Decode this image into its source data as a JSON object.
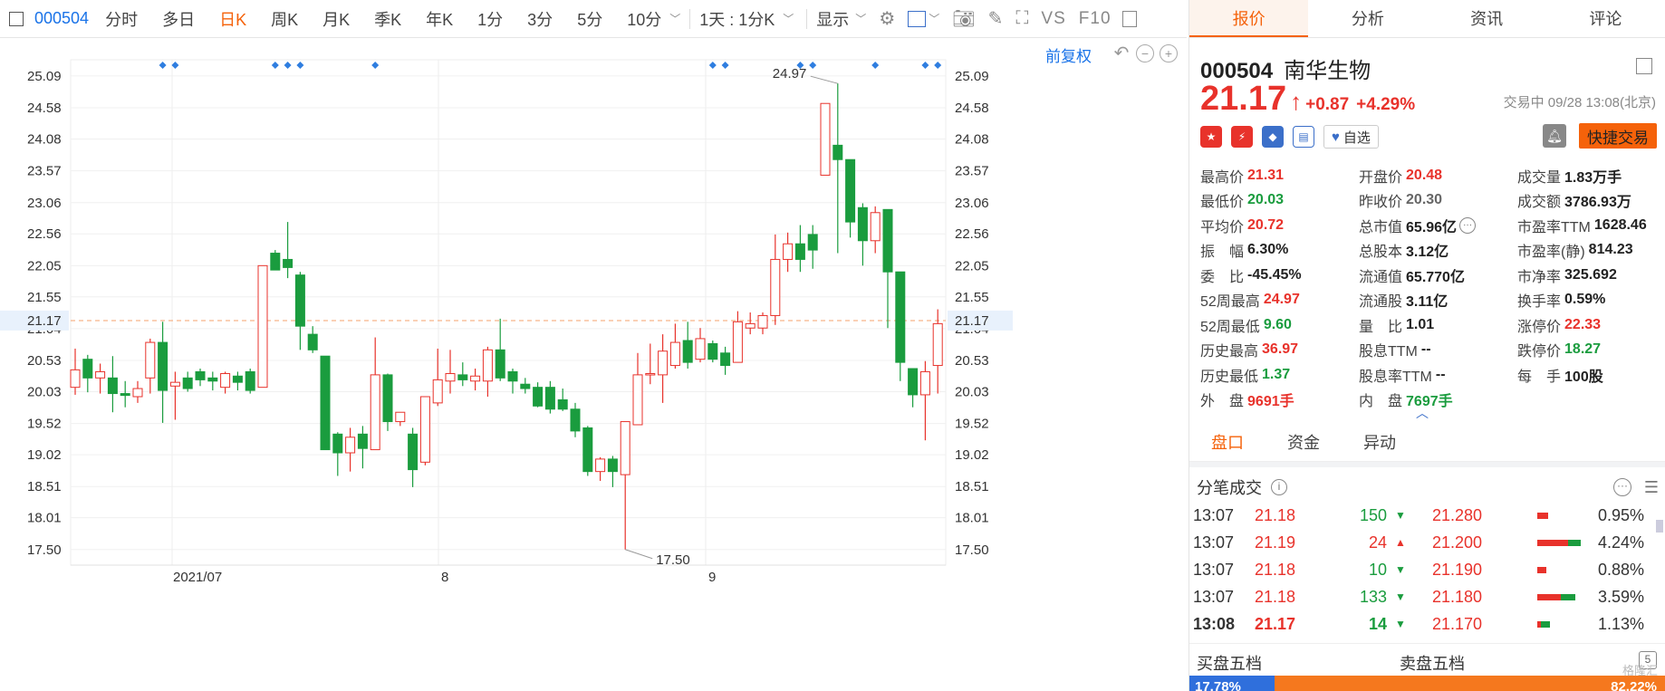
{
  "toolbar": {
    "code": "000504",
    "periods": [
      "分时",
      "多日",
      "日K",
      "周K",
      "月K",
      "季K",
      "年K",
      "1分",
      "3分",
      "5分",
      "10分"
    ],
    "active_period": "日K",
    "interval": "1天 : 1分K",
    "display": "显示",
    "vs": "VS",
    "f10": "F10"
  },
  "chart": {
    "fuquan": "前复权",
    "last_price_tag": "21.17",
    "high_annotation": "24.97",
    "low_annotation": "17.50"
  },
  "chart_data": {
    "type": "candlestick",
    "y_ticks": [
      "25.09",
      "24.58",
      "24.08",
      "23.57",
      "23.06",
      "22.56",
      "22.05",
      "21.55",
      "21.04",
      "20.53",
      "20.03",
      "19.52",
      "19.02",
      "18.51",
      "18.01",
      "17.50"
    ],
    "x_ticks": [
      "2021/07",
      "8",
      "9"
    ],
    "ylim": [
      17.25,
      25.35
    ],
    "last_price": 21.17,
    "colors": {
      "up": "#e8322b",
      "down": "#1a9c3e",
      "dashed_line": "#f5a26e"
    },
    "marker_groups": [
      [
        7,
        8
      ],
      [
        16,
        17,
        18
      ],
      [
        24
      ],
      [
        51,
        52
      ],
      [
        58,
        59
      ],
      [
        64
      ],
      [
        68,
        69
      ]
    ],
    "candles": [
      {
        "o": 20.1,
        "c": 20.38,
        "h": 20.72,
        "l": 19.98
      },
      {
        "o": 20.55,
        "c": 20.25,
        "h": 20.62,
        "l": 20.02
      },
      {
        "o": 20.25,
        "c": 20.35,
        "h": 20.48,
        "l": 20.0
      },
      {
        "o": 20.25,
        "c": 20.0,
        "h": 20.6,
        "l": 19.7
      },
      {
        "o": 20.0,
        "c": 19.97,
        "h": 20.2,
        "l": 19.78
      },
      {
        "o": 19.95,
        "c": 20.08,
        "h": 20.2,
        "l": 19.85
      },
      {
        "o": 20.25,
        "c": 20.82,
        "h": 20.88,
        "l": 20.0
      },
      {
        "o": 20.82,
        "c": 20.05,
        "h": 21.15,
        "l": 19.53
      },
      {
        "o": 20.12,
        "c": 20.18,
        "h": 20.35,
        "l": 19.58
      },
      {
        "o": 20.25,
        "c": 20.08,
        "h": 20.35,
        "l": 20.03
      },
      {
        "o": 20.35,
        "c": 20.22,
        "h": 20.4,
        "l": 20.12
      },
      {
        "o": 20.25,
        "c": 20.2,
        "h": 20.35,
        "l": 20.05
      },
      {
        "o": 20.1,
        "c": 20.32,
        "h": 20.35,
        "l": 20.0
      },
      {
        "o": 20.28,
        "c": 20.18,
        "h": 20.35,
        "l": 20.05
      },
      {
        "o": 20.35,
        "c": 20.05,
        "h": 20.4,
        "l": 20.0
      },
      {
        "o": 20.1,
        "c": 22.05,
        "h": 22.05,
        "l": 20.1
      },
      {
        "o": 22.25,
        "c": 21.98,
        "h": 22.3,
        "l": 21.98
      },
      {
        "o": 22.15,
        "c": 22.02,
        "h": 22.75,
        "l": 21.85
      },
      {
        "o": 21.9,
        "c": 21.08,
        "h": 21.95,
        "l": 20.7
      },
      {
        "o": 20.95,
        "c": 20.7,
        "h": 21.08,
        "l": 20.65
      },
      {
        "o": 20.6,
        "c": 19.1,
        "h": 20.6,
        "l": 19.1
      },
      {
        "o": 19.35,
        "c": 19.05,
        "h": 19.38,
        "l": 18.68
      },
      {
        "o": 19.05,
        "c": 19.3,
        "h": 19.45,
        "l": 18.75
      },
      {
        "o": 19.35,
        "c": 19.12,
        "h": 19.48,
        "l": 18.8
      },
      {
        "o": 19.1,
        "c": 20.3,
        "h": 20.9,
        "l": 19.1
      },
      {
        "o": 20.3,
        "c": 19.55,
        "h": 20.32,
        "l": 19.4
      },
      {
        "o": 19.55,
        "c": 19.7,
        "h": 19.7,
        "l": 19.48
      },
      {
        "o": 19.35,
        "c": 18.78,
        "h": 19.45,
        "l": 18.5
      },
      {
        "o": 18.9,
        "c": 19.95,
        "h": 19.95,
        "l": 18.85
      },
      {
        "o": 19.85,
        "c": 20.22,
        "h": 20.72,
        "l": 19.8
      },
      {
        "o": 20.2,
        "c": 20.32,
        "h": 20.7,
        "l": 20.0
      },
      {
        "o": 20.3,
        "c": 20.22,
        "h": 20.5,
        "l": 20.12
      },
      {
        "o": 20.2,
        "c": 20.28,
        "h": 20.4,
        "l": 20.05
      },
      {
        "o": 20.2,
        "c": 20.7,
        "h": 20.75,
        "l": 19.95
      },
      {
        "o": 20.7,
        "c": 20.25,
        "h": 21.2,
        "l": 20.2
      },
      {
        "o": 20.35,
        "c": 20.2,
        "h": 20.4,
        "l": 20.0
      },
      {
        "o": 20.15,
        "c": 20.08,
        "h": 20.25,
        "l": 20.0
      },
      {
        "o": 20.1,
        "c": 19.8,
        "h": 20.18,
        "l": 19.78
      },
      {
        "o": 20.1,
        "c": 19.75,
        "h": 20.2,
        "l": 19.68
      },
      {
        "o": 19.9,
        "c": 19.75,
        "h": 20.08,
        "l": 19.72
      },
      {
        "o": 19.75,
        "c": 19.4,
        "h": 19.85,
        "l": 19.3
      },
      {
        "o": 19.45,
        "c": 18.75,
        "h": 19.48,
        "l": 18.68
      },
      {
        "o": 18.75,
        "c": 18.95,
        "h": 18.98,
        "l": 18.6
      },
      {
        "o": 18.95,
        "c": 18.75,
        "h": 19.0,
        "l": 18.5
      },
      {
        "o": 18.7,
        "c": 19.55,
        "h": 19.55,
        "l": 17.5
      },
      {
        "o": 19.5,
        "c": 20.3,
        "h": 20.65,
        "l": 19.5
      },
      {
        "o": 20.3,
        "c": 20.32,
        "h": 20.8,
        "l": 20.15
      },
      {
        "o": 20.3,
        "c": 20.68,
        "h": 20.95,
        "l": 19.85
      },
      {
        "o": 20.45,
        "c": 20.82,
        "h": 21.12,
        "l": 20.4
      },
      {
        "o": 20.85,
        "c": 20.5,
        "h": 21.15,
        "l": 20.4
      },
      {
        "o": 20.55,
        "c": 20.88,
        "h": 21.05,
        "l": 20.5
      },
      {
        "o": 20.8,
        "c": 20.55,
        "h": 20.85,
        "l": 20.5
      },
      {
        "o": 20.65,
        "c": 20.45,
        "h": 20.75,
        "l": 20.3
      },
      {
        "o": 20.5,
        "c": 21.15,
        "h": 21.32,
        "l": 20.5
      },
      {
        "o": 21.05,
        "c": 21.12,
        "h": 21.3,
        "l": 20.95
      },
      {
        "o": 21.05,
        "c": 21.25,
        "h": 21.3,
        "l": 20.95
      },
      {
        "o": 21.25,
        "c": 22.15,
        "h": 22.55,
        "l": 21.1
      },
      {
        "o": 22.15,
        "c": 22.4,
        "h": 22.58,
        "l": 21.95
      },
      {
        "o": 22.4,
        "c": 22.15,
        "h": 22.7,
        "l": 21.95
      },
      {
        "o": 22.55,
        "c": 22.3,
        "h": 22.7,
        "l": 22.0
      },
      {
        "o": 23.5,
        "c": 24.65,
        "h": 24.65,
        "l": 23.5
      },
      {
        "o": 23.98,
        "c": 23.75,
        "h": 24.97,
        "l": 22.25
      },
      {
        "o": 23.75,
        "c": 22.75,
        "h": 23.75,
        "l": 22.5
      },
      {
        "o": 22.98,
        "c": 22.45,
        "h": 23.05,
        "l": 22.05
      },
      {
        "o": 22.45,
        "c": 22.9,
        "h": 23.0,
        "l": 22.25
      },
      {
        "o": 22.95,
        "c": 21.95,
        "h": 22.95,
        "l": 21.05
      },
      {
        "o": 21.95,
        "c": 20.5,
        "h": 21.95,
        "l": 20.2
      },
      {
        "o": 20.4,
        "c": 19.98,
        "h": 20.4,
        "l": 19.78
      },
      {
        "o": 19.98,
        "c": 20.35,
        "h": 20.52,
        "l": 19.25
      },
      {
        "o": 20.45,
        "c": 21.12,
        "h": 21.35,
        "l": 20.0
      }
    ]
  },
  "right": {
    "tabs": [
      "报价",
      "分析",
      "资讯",
      "评论"
    ],
    "active_tab": "报价",
    "code": "000504",
    "name": "南华生物",
    "price": "21.17",
    "change": "+0.87",
    "change_pct": "+4.29%",
    "trade_time": "交易中 09/28 13:08(北京)",
    "watch_label": "自选",
    "quick_trade": "快捷交易",
    "tag_colors": [
      "#e8322b",
      "#e8322b",
      "#3b6fc9",
      "#3b6fc9"
    ],
    "stats": [
      [
        {
          "k": "最高价",
          "v": "21.31",
          "c": "up"
        },
        {
          "k": "开盘价",
          "v": "20.48",
          "c": "up"
        },
        {
          "k": "成交量",
          "v": "1.83万手",
          "c": ""
        }
      ],
      [
        {
          "k": "最低价",
          "v": "20.03",
          "c": "dn"
        },
        {
          "k": "昨收价",
          "v": "20.30",
          "c": "gray"
        },
        {
          "k": "成交额",
          "v": "3786.93万",
          "c": ""
        }
      ],
      [
        {
          "k": "平均价",
          "v": "20.72",
          "c": "up"
        },
        {
          "k": "总市值",
          "v": "65.96亿",
          "c": "",
          "more": true
        },
        {
          "k": "市盈率TTM",
          "v": "1628.46",
          "c": ""
        }
      ],
      [
        {
          "k": "振　幅",
          "v": "6.30%",
          "c": ""
        },
        {
          "k": "总股本",
          "v": "3.12亿",
          "c": ""
        },
        {
          "k": "市盈率(静)",
          "v": "814.23",
          "c": ""
        }
      ],
      [
        {
          "k": "委　比",
          "v": "-45.45%",
          "c": ""
        },
        {
          "k": "流通值",
          "v": "65.770亿",
          "c": ""
        },
        {
          "k": "市净率",
          "v": "325.692",
          "c": ""
        }
      ],
      [
        {
          "k": "52周最高",
          "v": "24.97",
          "c": "up"
        },
        {
          "k": "流通股",
          "v": "3.11亿",
          "c": ""
        },
        {
          "k": "换手率",
          "v": "0.59%",
          "c": ""
        }
      ],
      [
        {
          "k": "52周最低",
          "v": "9.60",
          "c": "dn"
        },
        {
          "k": "量　比",
          "v": "1.01",
          "c": ""
        },
        {
          "k": "涨停价",
          "v": "22.33",
          "c": "up"
        }
      ],
      [
        {
          "k": "历史最高",
          "v": "36.97",
          "c": "up"
        },
        {
          "k": "股息TTM",
          "v": "--",
          "c": ""
        },
        {
          "k": "跌停价",
          "v": "18.27",
          "c": "dn"
        }
      ],
      [
        {
          "k": "历史最低",
          "v": "1.37",
          "c": "dn"
        },
        {
          "k": "股息率TTM",
          "v": "--",
          "c": ""
        },
        {
          "k": "每　手",
          "v": "100股",
          "c": ""
        }
      ],
      [
        {
          "k": "外　盘",
          "v": "9691手",
          "c": "up"
        },
        {
          "k": "内　盘",
          "v": "7697手",
          "c": "dn"
        },
        {
          "k": "",
          "v": "",
          "c": ""
        }
      ]
    ],
    "subtabs": [
      "盘口",
      "资金",
      "异动"
    ],
    "active_subtab": "盘口",
    "fenbi_title": "分笔成交",
    "trades": [
      {
        "t": "13:07",
        "p": "21.18",
        "vol": "150",
        "dir": "dn",
        "lp": "21.280",
        "pct": "0.95%",
        "bar": [
          12,
          0
        ]
      },
      {
        "t": "13:07",
        "p": "21.19",
        "vol": "24",
        "dir": "up",
        "lp": "21.200",
        "pct": "4.24%",
        "bar": [
          34,
          14
        ]
      },
      {
        "t": "13:07",
        "p": "21.18",
        "vol": "10",
        "dir": "dn",
        "lp": "21.190",
        "pct": "0.88%",
        "bar": [
          10,
          0
        ]
      },
      {
        "t": "13:07",
        "p": "21.18",
        "vol": "133",
        "dir": "dn",
        "lp": "21.180",
        "pct": "3.59%",
        "bar": [
          26,
          16
        ]
      },
      {
        "t": "13:08",
        "p": "21.17",
        "vol": "14",
        "dir": "dn",
        "lp": "21.170",
        "pct": "1.13%",
        "bar": [
          4,
          10
        ],
        "bold": true
      }
    ],
    "five_buy": "买盘五档",
    "five_sell": "卖盘五档",
    "ratio_buy": "17.78%",
    "ratio_sell": "82.22%",
    "watermark": "格隆汇"
  }
}
